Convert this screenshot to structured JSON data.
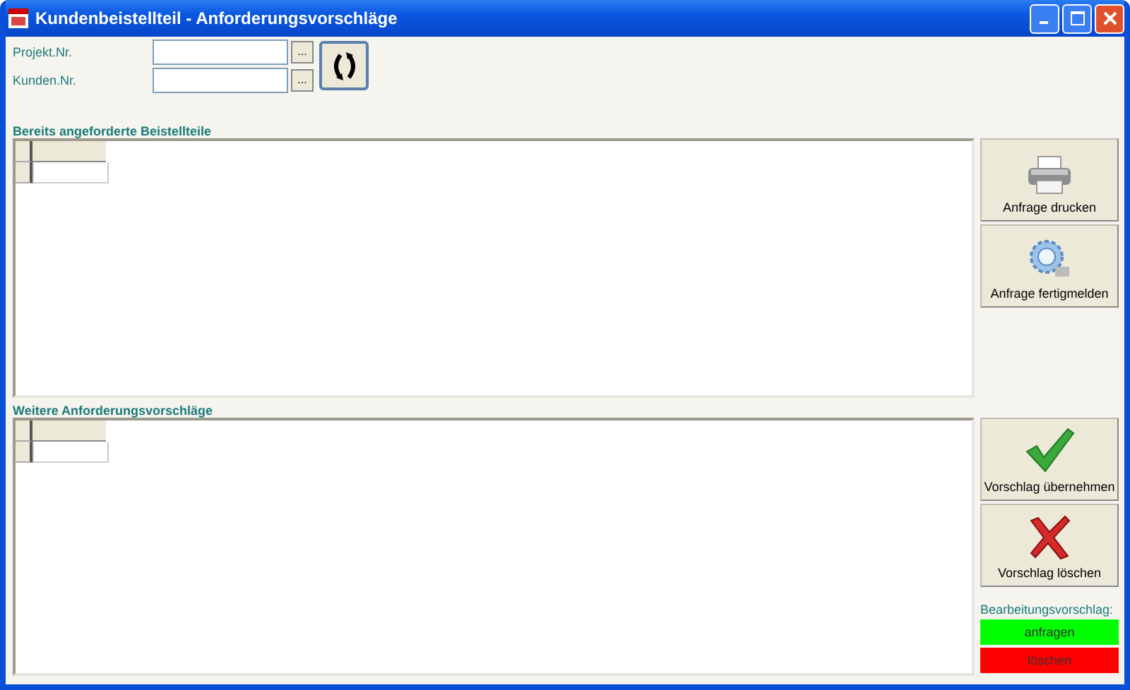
{
  "window": {
    "title": "Kundenbeistellteil - Anforderungsvorschläge"
  },
  "fields": [
    {
      "label": "Projekt.Nr.",
      "browse": "..."
    },
    {
      "label": "Kunden.Nr.",
      "browse": "..."
    }
  ],
  "sections": [
    {
      "title": "Bereits angeforderte Beistellteile",
      "buttons": [
        {
          "kind": "printer",
          "label": "Anfrage drucken"
        },
        {
          "kind": "gear",
          "label": "Anfrage fertigmelden"
        }
      ]
    },
    {
      "title": "Weitere Anforderungsvorschläge",
      "buttons": [
        {
          "kind": "check",
          "label": "Vorschlag übernehmen"
        },
        {
          "kind": "cross",
          "label": "Vorschlag löschen"
        }
      ]
    }
  ],
  "legend": {
    "title": "Bearbeitungsvorschlag:",
    "items": [
      {
        "label": "anfragen",
        "color": "#00ff00"
      },
      {
        "label": "löschen",
        "color": "#ff0000"
      }
    ]
  }
}
